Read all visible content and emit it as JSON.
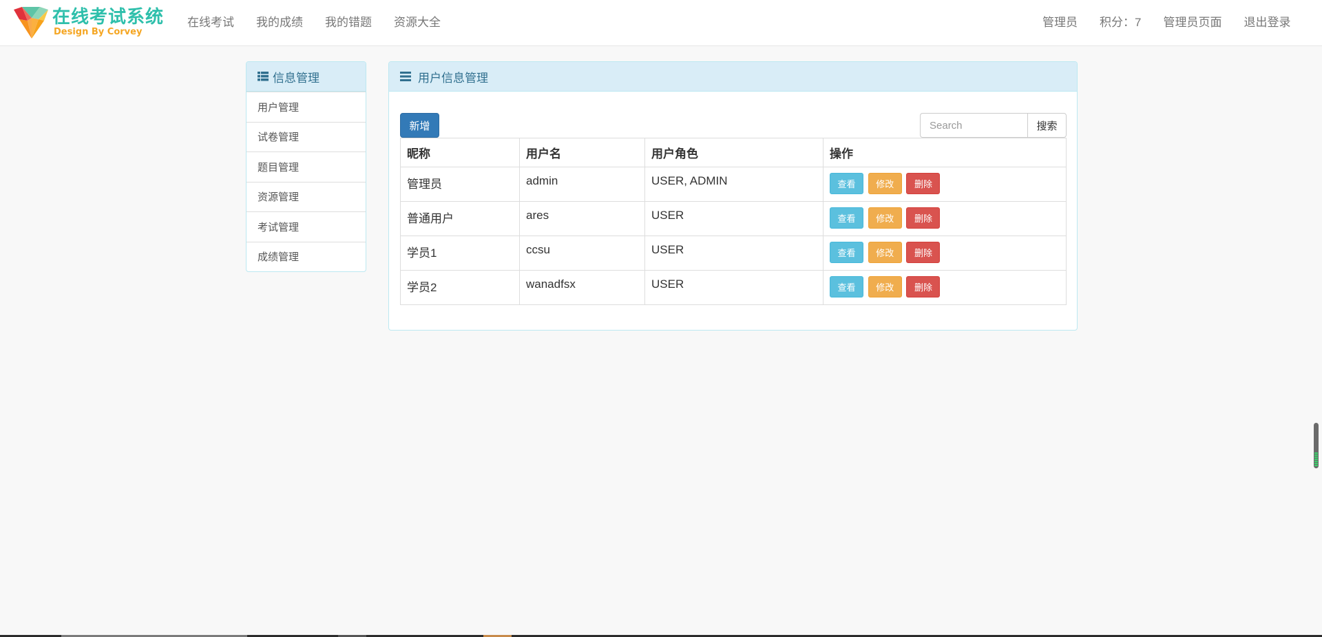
{
  "brand": {
    "title": "在线考试系统",
    "subtitle": "Design By Corvey"
  },
  "nav": {
    "left": [
      {
        "label": "在线考试"
      },
      {
        "label": "我的成绩"
      },
      {
        "label": "我的错题"
      },
      {
        "label": "资源大全"
      }
    ],
    "right": [
      {
        "label": "管理员"
      },
      {
        "label": "积分：7"
      },
      {
        "label": "管理员页面"
      },
      {
        "label": "退出登录"
      }
    ]
  },
  "sidebar": {
    "heading": "信息管理",
    "heading_icon": "list-icon",
    "items": [
      {
        "label": "用户管理"
      },
      {
        "label": "试卷管理"
      },
      {
        "label": "题目管理"
      },
      {
        "label": "资源管理"
      },
      {
        "label": "考试管理"
      },
      {
        "label": "成绩管理"
      }
    ]
  },
  "main": {
    "heading": "用户信息管理",
    "heading_icon": "hamburger-icon",
    "add_label": "新增",
    "search": {
      "placeholder": "Search",
      "value": "",
      "button_label": "搜索"
    },
    "table": {
      "columns": [
        "昵称",
        "用户名",
        "用户角色",
        "操作"
      ],
      "rows": [
        {
          "nickname": "管理员",
          "username": "admin",
          "roles": "USER, ADMIN"
        },
        {
          "nickname": "普通用户",
          "username": "ares",
          "roles": "USER"
        },
        {
          "nickname": "学员1",
          "username": "ccsu",
          "roles": "USER"
        },
        {
          "nickname": "学员2",
          "username": "wanadfsx",
          "roles": "USER"
        }
      ],
      "actions": {
        "view": "查看",
        "edit": "修改",
        "delete": "删除"
      }
    }
  },
  "colors": {
    "primary": "#337ab7",
    "info": "#5bc0de",
    "warning": "#f0ad4e",
    "danger": "#d9534f",
    "panel_heading_bg": "#d9edf7",
    "panel_heading_text": "#31708f",
    "brand_teal": "#2ebfab",
    "brand_orange": "#f5a623"
  }
}
